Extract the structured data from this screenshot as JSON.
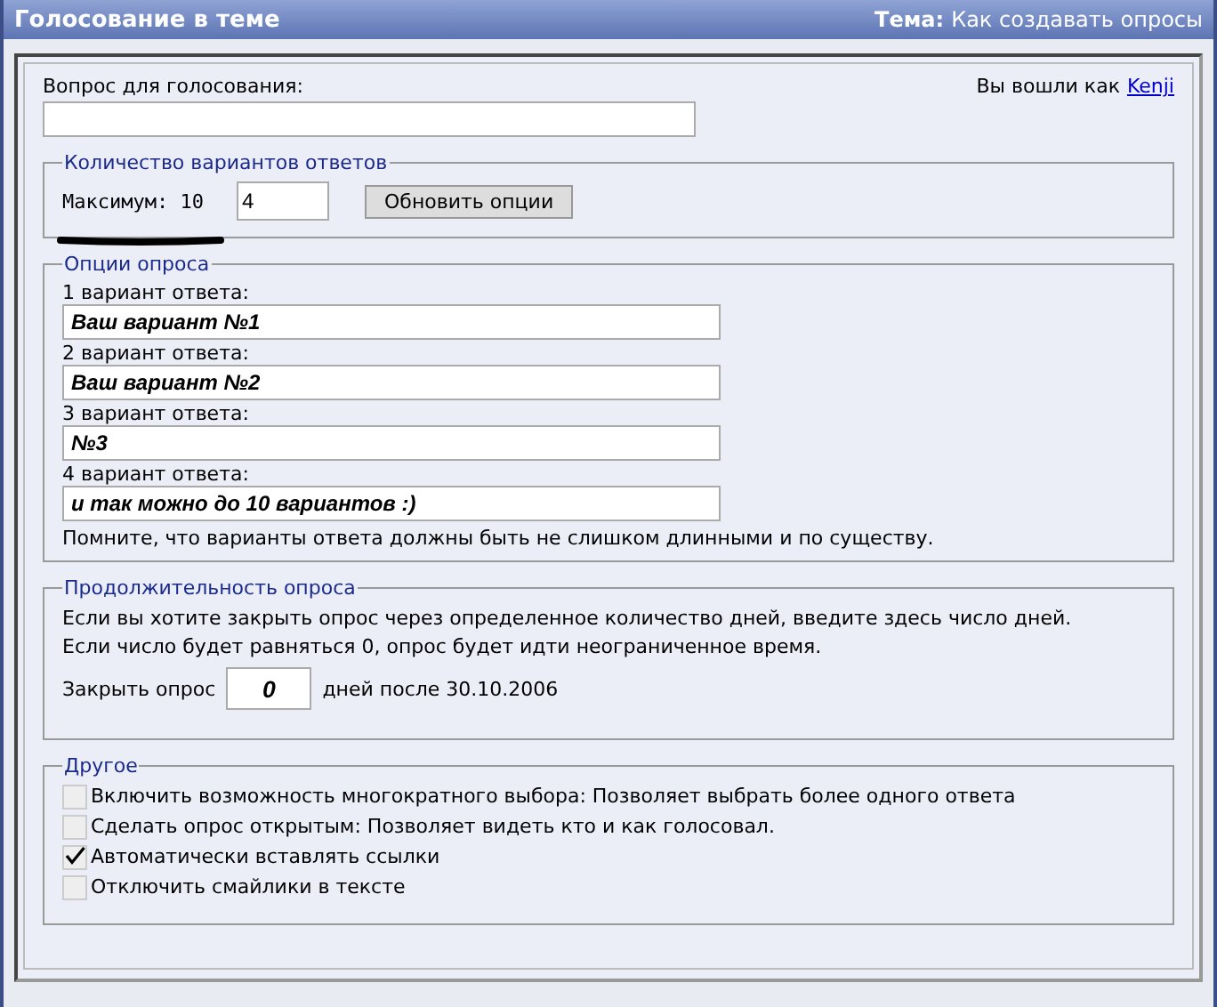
{
  "header": {
    "title": "Голосование в теме",
    "topic_label": "Тема:",
    "topic": "Как создавать опросы"
  },
  "question": {
    "label": "Вопрос для голосования:"
  },
  "login": {
    "text": "Вы вошли как",
    "user": "Kenji"
  },
  "count": {
    "legend": "Количество вариантов ответов",
    "max_label": "Максимум: 10",
    "value": "4",
    "button": "Обновить опции"
  },
  "options": {
    "legend": "Опции опроса",
    "items": [
      {
        "label": "1 вариант ответа:",
        "value": "Ваш вариант №1"
      },
      {
        "label": "2 вариант ответа:",
        "value": "Ваш вариант №2"
      },
      {
        "label": "3 вариант ответа:",
        "value": "№3"
      },
      {
        "label": "4 вариант ответа:",
        "value": "и так можно до 10 вариантов :)"
      }
    ],
    "note": "Помните, что варианты ответа должны быть не слишком длинными и по существу."
  },
  "duration": {
    "legend": "Продолжительность опроса",
    "lines": [
      "Если вы хотите закрыть опрос через определенное количество дней, введите здесь число дней.",
      "Если число будет равняться 0, опрос будет идти неограниченное время."
    ],
    "close_label": "Закрыть опрос",
    "value": "0",
    "after": "дней после 30.10.2006"
  },
  "other": {
    "legend": "Другое",
    "checkboxes": [
      {
        "label": "Включить возможность многократного выбора: Позволяет выбрать более одного ответа",
        "checked": false
      },
      {
        "label": "Сделать опрос открытым: Позволяет видеть кто и как голосовал.",
        "checked": false
      },
      {
        "label": "Автоматически вставлять ссылки",
        "checked": true
      },
      {
        "label": "Отключить смайлики в тексте",
        "checked": false
      }
    ]
  }
}
